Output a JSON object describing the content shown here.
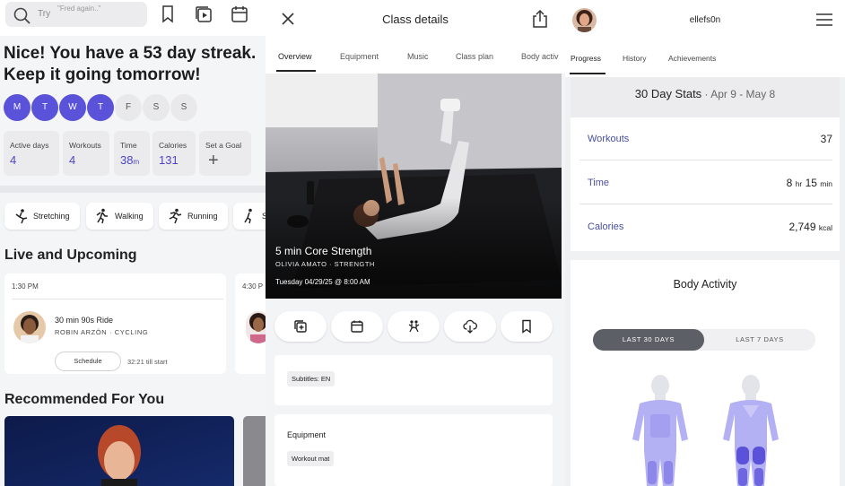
{
  "home": {
    "search_try": "Try",
    "search_hint": "\"Fred again..\"",
    "streak_line1": "Nice! You have a 53 day streak.",
    "streak_line2": "Keep it going tomorrow!",
    "days": [
      "M",
      "T",
      "W",
      "T",
      "F",
      "S",
      "S"
    ],
    "stats": [
      {
        "label": "Active days",
        "value": "4",
        "unit": ""
      },
      {
        "label": "Workouts",
        "value": "4",
        "unit": ""
      },
      {
        "label": "Time",
        "value": "38",
        "unit": "m"
      },
      {
        "label": "Calories",
        "value": "131",
        "unit": ""
      }
    ],
    "set_goal_label": "Set a Goal",
    "categories": [
      "Stretching",
      "Walking",
      "Running",
      "S"
    ],
    "live_title": "Live and Upcoming",
    "live_card": {
      "time": "1:30 PM",
      "class_name": "30 min 90s Ride",
      "instructor": "ROBIN ARZÓN",
      "discipline": "CYCLING",
      "schedule_label": "Schedule",
      "till_start": "32:21 till start"
    },
    "live_card2_time": "4:30 P",
    "recommended_title": "Recommended For You"
  },
  "class": {
    "header_title": "Class details",
    "tabs": [
      "Overview",
      "Equipment",
      "Music",
      "Class plan",
      "Body activ"
    ],
    "class_title": "5 min Core Strength",
    "instructor": "OLIVIA AMATO",
    "discipline": "STRENGTH",
    "datetime": "Tuesday 04/29/25 @ 8:00 AM",
    "subtitles": "Subtitles: EN",
    "equipment_heading": "Equipment",
    "equipment_item": "Workout mat"
  },
  "profile": {
    "username": "ellefs0n",
    "tabs": [
      "Progress",
      "History",
      "Achievements"
    ],
    "stats_title": "30 Day Stats",
    "stats_range": "Apr 9 - May 8",
    "workouts_label": "Workouts",
    "workouts_value": "37",
    "time_label": "Time",
    "time_hr": "8",
    "time_hr_unit": "hr",
    "time_min": "15",
    "time_min_unit": "min",
    "calories_label": "Calories",
    "calories_value": "2,749",
    "calories_unit": "kcal",
    "body_title": "Body Activity",
    "seg_active": "LAST 30 DAYS",
    "seg_inactive": "LAST 7 DAYS"
  },
  "colors": {
    "accent": "#5a52d8",
    "stat_value": "#4c45c9",
    "muscle": "#b4b0f4"
  }
}
